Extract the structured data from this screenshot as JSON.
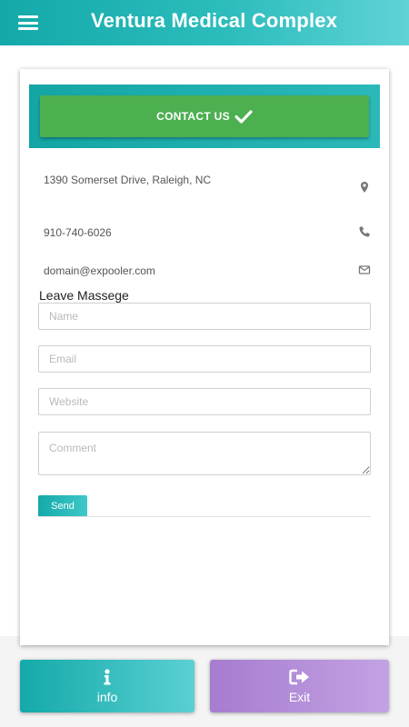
{
  "app": {
    "title": "Ventura Medical Complex",
    "colors": {
      "primary": "#14a9a9",
      "success": "#4caf50",
      "exit": "#b08cd9"
    }
  },
  "contact_button": {
    "label": "CONTACT US",
    "icon": "check-icon"
  },
  "contact_info": {
    "address": "1390 Somerset Drive, Raleigh, NC",
    "address_icon": "map-marker-icon",
    "phone": "910-740-6026",
    "phone_icon": "phone-icon",
    "email": "domain@expooler.com",
    "email_icon": "envelope-icon"
  },
  "form": {
    "title": "Leave Massege",
    "name_placeholder": "Name",
    "email_placeholder": "Email",
    "website_placeholder": "Website",
    "comment_placeholder": "Comment",
    "send_label": "Send"
  },
  "bottom_nav": {
    "info_label": "info",
    "info_icon": "info-icon",
    "exit_label": "Exit",
    "exit_icon": "sign-out-icon"
  }
}
